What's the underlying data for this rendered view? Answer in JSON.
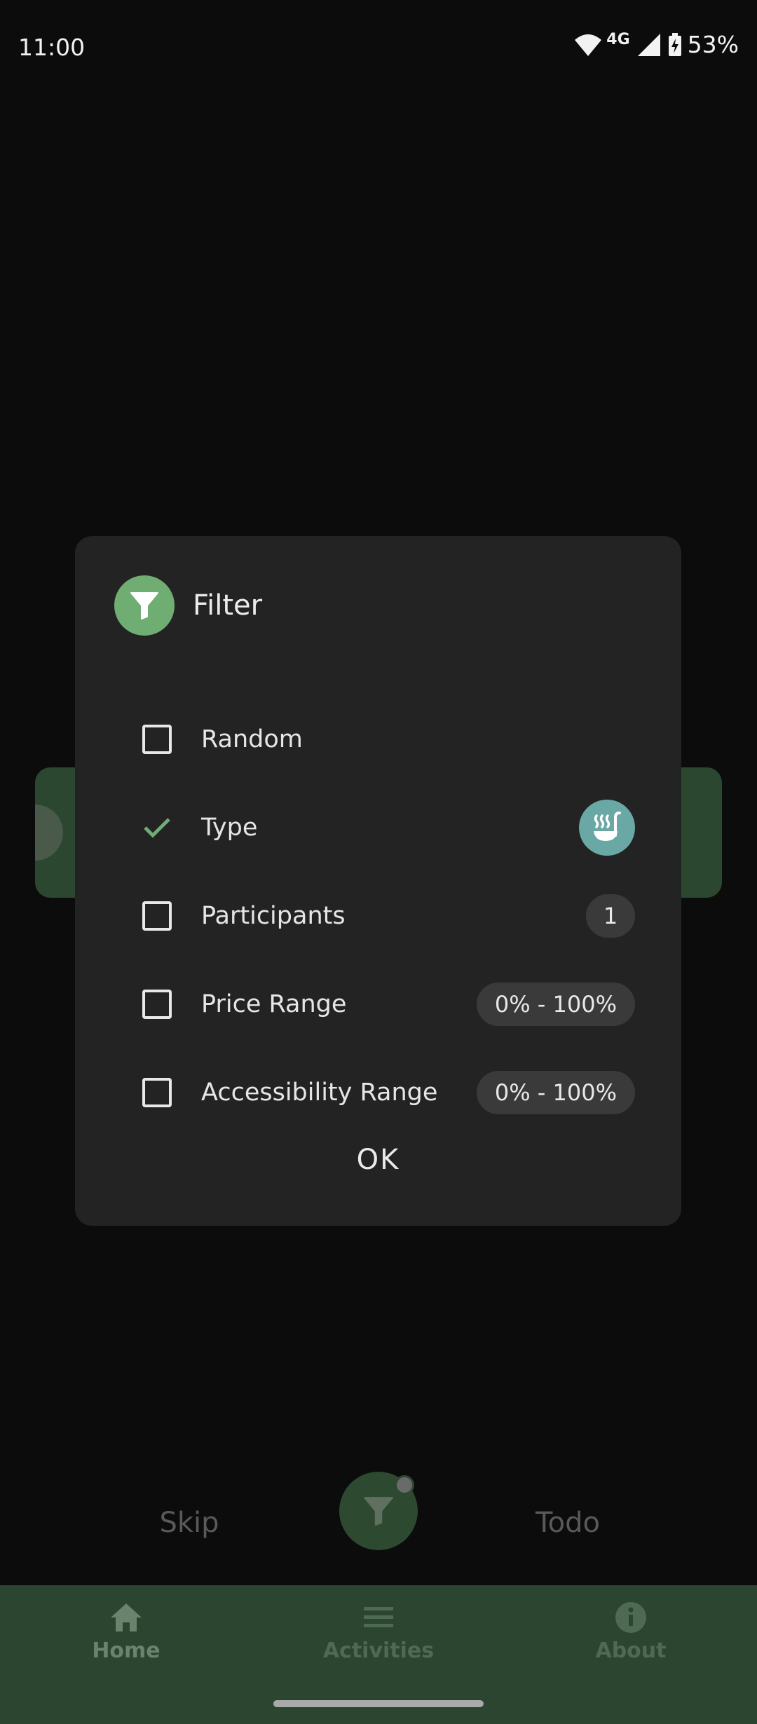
{
  "status_bar": {
    "time": "11:00",
    "network": "4G",
    "battery": "53%"
  },
  "dialog": {
    "title": "Filter",
    "icon": "filter-icon",
    "rows": [
      {
        "label": "Random",
        "checked": false
      },
      {
        "label": "Type",
        "checked": true,
        "badge_icon": "ladle-soup-icon"
      },
      {
        "label": "Participants",
        "checked": false,
        "value": "1"
      },
      {
        "label": "Price Range",
        "checked": false,
        "value": "0% - 100%"
      },
      {
        "label": "Accessibility Range",
        "checked": false,
        "value": "0% - 100%"
      }
    ],
    "ok_label": "OK"
  },
  "controls": {
    "skip_label": "Skip",
    "todo_label": "Todo",
    "fab_icon": "filter-icon"
  },
  "bottom_nav": {
    "items": [
      {
        "label": "Home",
        "icon": "home-icon",
        "active": true
      },
      {
        "label": "Activities",
        "icon": "list-icon",
        "active": false
      },
      {
        "label": "About",
        "icon": "info-icon",
        "active": false
      }
    ]
  },
  "colors": {
    "accent_green": "#6fad72",
    "type_badge": "#6aa8a6",
    "nav_background": "#2c4530",
    "dialog_background": "#232323"
  }
}
